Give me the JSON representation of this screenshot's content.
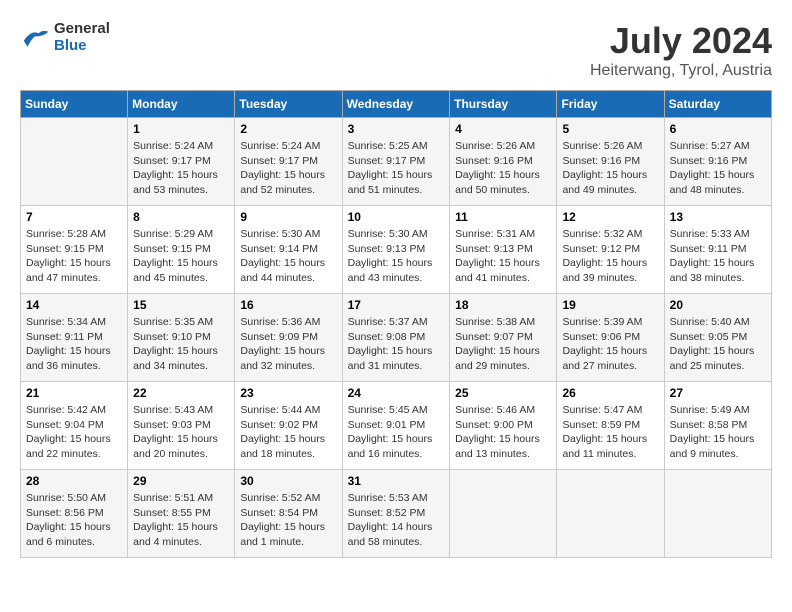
{
  "header": {
    "logo_line1": "General",
    "logo_line2": "Blue",
    "month_year": "July 2024",
    "location": "Heiterwang, Tyrol, Austria"
  },
  "weekdays": [
    "Sunday",
    "Monday",
    "Tuesday",
    "Wednesday",
    "Thursday",
    "Friday",
    "Saturday"
  ],
  "weeks": [
    [
      {
        "day": "",
        "info": ""
      },
      {
        "day": "1",
        "info": "Sunrise: 5:24 AM\nSunset: 9:17 PM\nDaylight: 15 hours\nand 53 minutes."
      },
      {
        "day": "2",
        "info": "Sunrise: 5:24 AM\nSunset: 9:17 PM\nDaylight: 15 hours\nand 52 minutes."
      },
      {
        "day": "3",
        "info": "Sunrise: 5:25 AM\nSunset: 9:17 PM\nDaylight: 15 hours\nand 51 minutes."
      },
      {
        "day": "4",
        "info": "Sunrise: 5:26 AM\nSunset: 9:16 PM\nDaylight: 15 hours\nand 50 minutes."
      },
      {
        "day": "5",
        "info": "Sunrise: 5:26 AM\nSunset: 9:16 PM\nDaylight: 15 hours\nand 49 minutes."
      },
      {
        "day": "6",
        "info": "Sunrise: 5:27 AM\nSunset: 9:16 PM\nDaylight: 15 hours\nand 48 minutes."
      }
    ],
    [
      {
        "day": "7",
        "info": "Sunrise: 5:28 AM\nSunset: 9:15 PM\nDaylight: 15 hours\nand 47 minutes."
      },
      {
        "day": "8",
        "info": "Sunrise: 5:29 AM\nSunset: 9:15 PM\nDaylight: 15 hours\nand 45 minutes."
      },
      {
        "day": "9",
        "info": "Sunrise: 5:30 AM\nSunset: 9:14 PM\nDaylight: 15 hours\nand 44 minutes."
      },
      {
        "day": "10",
        "info": "Sunrise: 5:30 AM\nSunset: 9:13 PM\nDaylight: 15 hours\nand 43 minutes."
      },
      {
        "day": "11",
        "info": "Sunrise: 5:31 AM\nSunset: 9:13 PM\nDaylight: 15 hours\nand 41 minutes."
      },
      {
        "day": "12",
        "info": "Sunrise: 5:32 AM\nSunset: 9:12 PM\nDaylight: 15 hours\nand 39 minutes."
      },
      {
        "day": "13",
        "info": "Sunrise: 5:33 AM\nSunset: 9:11 PM\nDaylight: 15 hours\nand 38 minutes."
      }
    ],
    [
      {
        "day": "14",
        "info": "Sunrise: 5:34 AM\nSunset: 9:11 PM\nDaylight: 15 hours\nand 36 minutes."
      },
      {
        "day": "15",
        "info": "Sunrise: 5:35 AM\nSunset: 9:10 PM\nDaylight: 15 hours\nand 34 minutes."
      },
      {
        "day": "16",
        "info": "Sunrise: 5:36 AM\nSunset: 9:09 PM\nDaylight: 15 hours\nand 32 minutes."
      },
      {
        "day": "17",
        "info": "Sunrise: 5:37 AM\nSunset: 9:08 PM\nDaylight: 15 hours\nand 31 minutes."
      },
      {
        "day": "18",
        "info": "Sunrise: 5:38 AM\nSunset: 9:07 PM\nDaylight: 15 hours\nand 29 minutes."
      },
      {
        "day": "19",
        "info": "Sunrise: 5:39 AM\nSunset: 9:06 PM\nDaylight: 15 hours\nand 27 minutes."
      },
      {
        "day": "20",
        "info": "Sunrise: 5:40 AM\nSunset: 9:05 PM\nDaylight: 15 hours\nand 25 minutes."
      }
    ],
    [
      {
        "day": "21",
        "info": "Sunrise: 5:42 AM\nSunset: 9:04 PM\nDaylight: 15 hours\nand 22 minutes."
      },
      {
        "day": "22",
        "info": "Sunrise: 5:43 AM\nSunset: 9:03 PM\nDaylight: 15 hours\nand 20 minutes."
      },
      {
        "day": "23",
        "info": "Sunrise: 5:44 AM\nSunset: 9:02 PM\nDaylight: 15 hours\nand 18 minutes."
      },
      {
        "day": "24",
        "info": "Sunrise: 5:45 AM\nSunset: 9:01 PM\nDaylight: 15 hours\nand 16 minutes."
      },
      {
        "day": "25",
        "info": "Sunrise: 5:46 AM\nSunset: 9:00 PM\nDaylight: 15 hours\nand 13 minutes."
      },
      {
        "day": "26",
        "info": "Sunrise: 5:47 AM\nSunset: 8:59 PM\nDaylight: 15 hours\nand 11 minutes."
      },
      {
        "day": "27",
        "info": "Sunrise: 5:49 AM\nSunset: 8:58 PM\nDaylight: 15 hours\nand 9 minutes."
      }
    ],
    [
      {
        "day": "28",
        "info": "Sunrise: 5:50 AM\nSunset: 8:56 PM\nDaylight: 15 hours\nand 6 minutes."
      },
      {
        "day": "29",
        "info": "Sunrise: 5:51 AM\nSunset: 8:55 PM\nDaylight: 15 hours\nand 4 minutes."
      },
      {
        "day": "30",
        "info": "Sunrise: 5:52 AM\nSunset: 8:54 PM\nDaylight: 15 hours\nand 1 minute."
      },
      {
        "day": "31",
        "info": "Sunrise: 5:53 AM\nSunset: 8:52 PM\nDaylight: 14 hours\nand 58 minutes."
      },
      {
        "day": "",
        "info": ""
      },
      {
        "day": "",
        "info": ""
      },
      {
        "day": "",
        "info": ""
      }
    ]
  ]
}
